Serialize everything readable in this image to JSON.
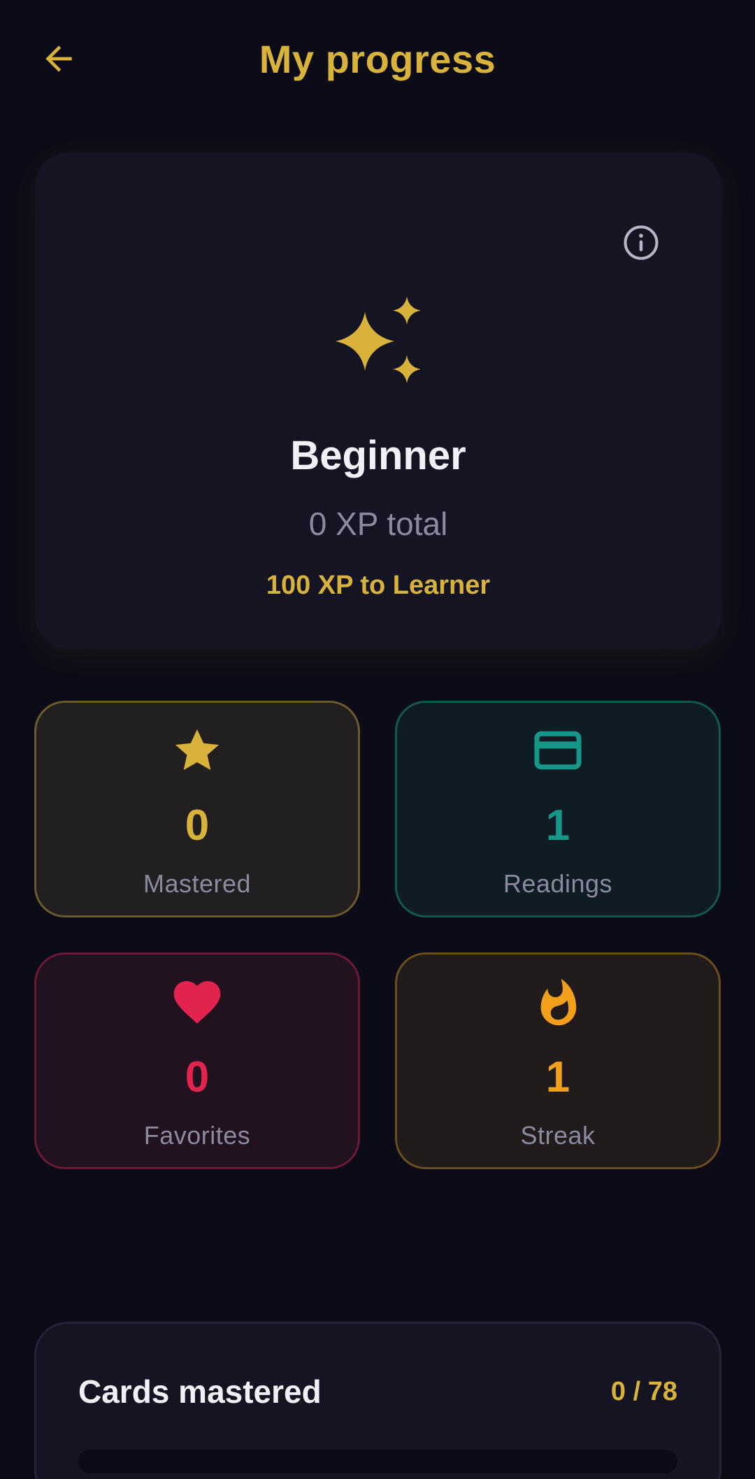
{
  "header": {
    "title": "My progress",
    "back_icon": "arrow-left-icon"
  },
  "level": {
    "name": "Beginner",
    "xp_total": "0 XP total",
    "next_level": "100 XP to Learner",
    "icon": "sparkles-icon",
    "info_icon": "info-circle-icon"
  },
  "stats": [
    {
      "key": "mastered",
      "icon": "star-icon",
      "value": "0",
      "label": "Mastered",
      "color": "#d8b23a"
    },
    {
      "key": "readings",
      "icon": "card-icon",
      "value": "1",
      "label": "Readings",
      "color": "#15978a"
    },
    {
      "key": "favorites",
      "icon": "heart-icon",
      "value": "0",
      "label": "Favorites",
      "color": "#e2234e"
    },
    {
      "key": "streak",
      "icon": "fire-icon",
      "value": "1",
      "label": "Streak",
      "color": "#f2a01b"
    }
  ],
  "cards_mastered": {
    "title": "Cards mastered",
    "count": "0 / 78",
    "progress": 0
  },
  "colors": {
    "accent": "#d8b23a",
    "background": "#0c0c18",
    "surface": "#141422"
  }
}
